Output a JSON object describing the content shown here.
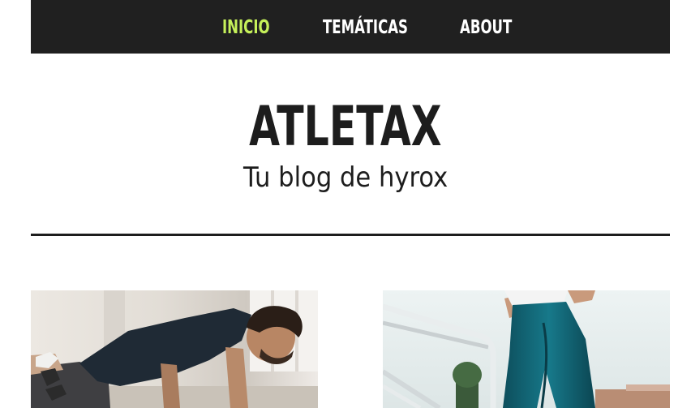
{
  "nav": {
    "items": [
      {
        "label": "Inicio",
        "active": true
      },
      {
        "label": "Temáticas",
        "active": false
      },
      {
        "label": "About",
        "active": false
      }
    ],
    "active_color": "#c5f05a",
    "background": "#202020"
  },
  "hero": {
    "title": "ATLETAX",
    "subtitle": "Tu blog de hyrox"
  },
  "posts": [
    {
      "image": "man-pushup-photo"
    },
    {
      "image": "woman-stairs-leggings-photo"
    }
  ]
}
